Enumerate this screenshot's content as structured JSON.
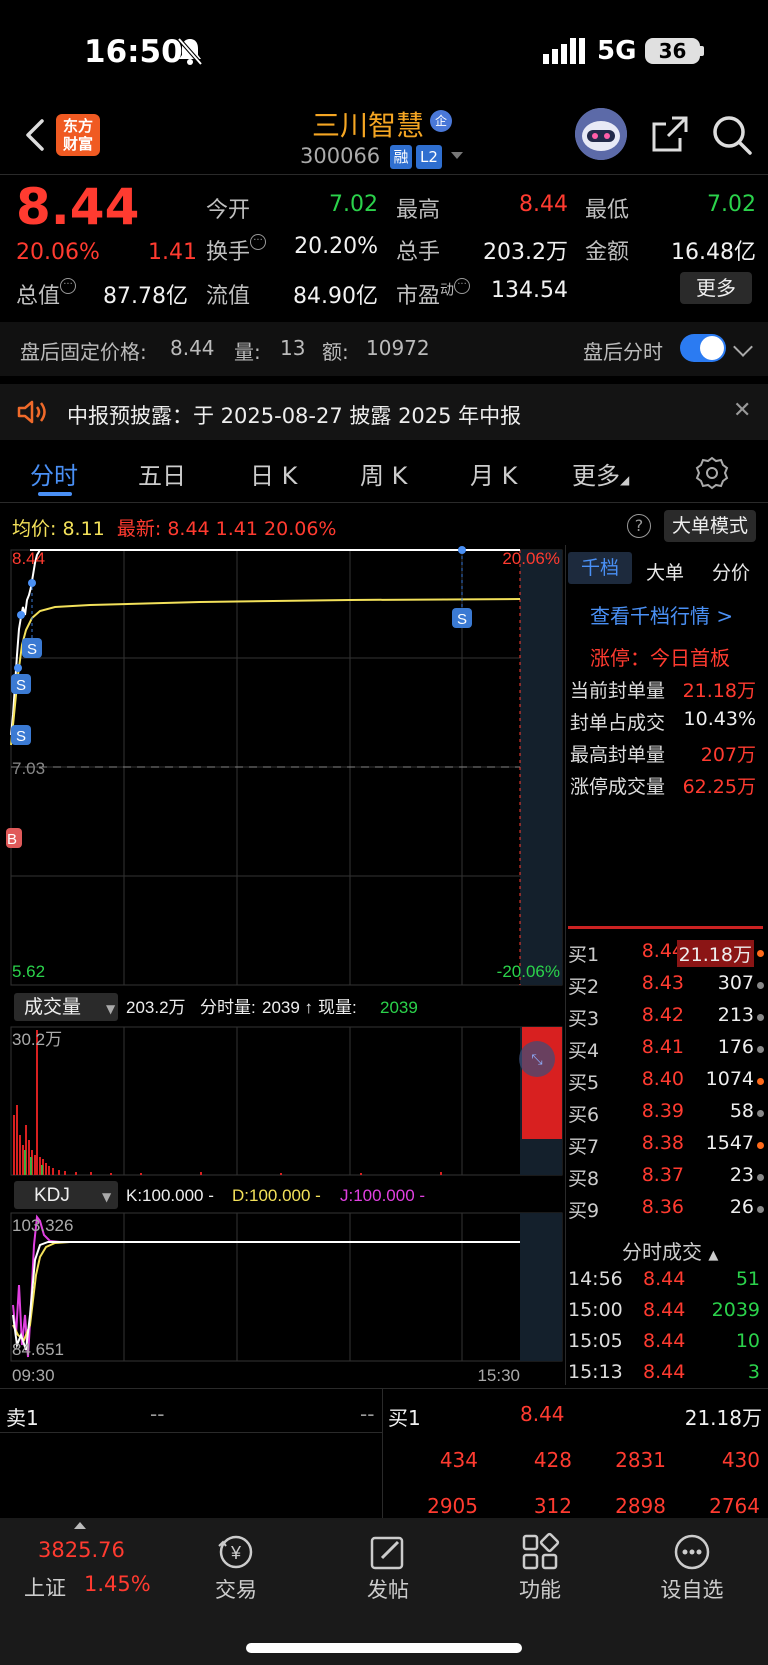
{
  "status_bar": {
    "time": "16:50",
    "network": "5G",
    "battery": "36"
  },
  "header": {
    "logo_line1": "东方",
    "logo_line2": "财富",
    "stock_name": "三川智慧",
    "name_badge": "企",
    "stock_code": "300066",
    "badge_margin": "融",
    "badge_level": "L2"
  },
  "quote": {
    "price": "8.44",
    "change_pct": "20.06%",
    "change_amt": "1.41",
    "fields": [
      {
        "label": "今开",
        "value": "7.02",
        "color": "green"
      },
      {
        "label": "最高",
        "value": "8.44",
        "color": "red"
      },
      {
        "label": "最低",
        "value": "7.02",
        "color": "green"
      },
      {
        "label": "换手",
        "value": "20.20%",
        "color": "white"
      },
      {
        "label": "总手",
        "value": "203.2万",
        "color": "white"
      },
      {
        "label": "金额",
        "value": "16.48亿",
        "color": "white"
      },
      {
        "label": "总值",
        "value": "87.78亿",
        "color": "white"
      },
      {
        "label": "流值",
        "value": "84.90亿",
        "color": "white"
      },
      {
        "label": "市盈",
        "label_sup": "动",
        "value": "134.54",
        "color": "white"
      }
    ],
    "more_button": "更多"
  },
  "after_hours": {
    "price_label": "盘后固定价格:",
    "price": "8.44",
    "volume_label": "量:",
    "volume": "13",
    "amount_label": "额:",
    "amount": "10972",
    "toggle_label": "盘后分时",
    "toggle_on": true
  },
  "notice": {
    "text": "中报预披露：于 2025-08-27 披露 2025 年中报"
  },
  "tabs": [
    "分时",
    "五日",
    "日 K",
    "周 K",
    "月 K",
    "更多"
  ],
  "price_bar": {
    "avg_label": "均价:",
    "avg_value": "8.11",
    "latest_label": "最新:",
    "latest_value": "8.44",
    "latest_change": "1.41",
    "latest_pct": "20.06%",
    "help": "?",
    "big_order_button": "大单模式"
  },
  "chart": {
    "price_high": "8.44",
    "price_mid": "7.03",
    "price_low": "5.62",
    "pct_high": "20.06%",
    "pct_low": "-20.06%",
    "volume_selector": "成交量",
    "volume_total": "203.2万",
    "volume_info_label": "分时量:",
    "volume_info_value": "2039 ↑",
    "volume_now_label": "现量:",
    "volume_now_value": "2039",
    "volume_max": "30.2万",
    "kdj_selector": "KDJ",
    "kdj_k": "K:100.000 -",
    "kdj_d": "D:100.000 -",
    "kdj_j": "J:100.000 -",
    "kdj_max": "103.326",
    "kdj_min": "84.651",
    "time_start": "09:30",
    "time_end": "15:30",
    "marker_s": "S",
    "marker_b": "B"
  },
  "right_panel": {
    "tabs": [
      "千档",
      "大单",
      "分价"
    ],
    "link": "查看千档行情 >",
    "limit_status": "涨停：今日首板",
    "stats": [
      {
        "label": "当前封单量",
        "value": "21.18万"
      },
      {
        "label": "封单占成交",
        "value": "10.43%"
      },
      {
        "label": "最高封单量",
        "value": "207万"
      },
      {
        "label": "涨停成交量",
        "value": "62.25万"
      }
    ],
    "bids": [
      {
        "label": "买1",
        "price": "8.44",
        "volume": "21.18万",
        "dot": "orange"
      },
      {
        "label": "买2",
        "price": "8.43",
        "volume": "307",
        "dot": "gray"
      },
      {
        "label": "买3",
        "price": "8.42",
        "volume": "213",
        "dot": "gray"
      },
      {
        "label": "买4",
        "price": "8.41",
        "volume": "176",
        "dot": "gray"
      },
      {
        "label": "买5",
        "price": "8.40",
        "volume": "1074",
        "dot": "orange"
      },
      {
        "label": "买6",
        "price": "8.39",
        "volume": "58",
        "dot": "gray"
      },
      {
        "label": "买7",
        "price": "8.38",
        "volume": "1547",
        "dot": "orange"
      },
      {
        "label": "买8",
        "price": "8.37",
        "volume": "23",
        "dot": "gray"
      },
      {
        "label": "买9",
        "price": "8.36",
        "volume": "26",
        "dot": "gray"
      }
    ],
    "trades_title": "分时成交",
    "trades": [
      {
        "time": "14:56",
        "price": "8.44",
        "volume": "51"
      },
      {
        "time": "15:00",
        "price": "8.44",
        "volume": "2039"
      },
      {
        "time": "15:05",
        "price": "8.44",
        "volume": "10"
      },
      {
        "time": "15:13",
        "price": "8.44",
        "volume": "3"
      }
    ]
  },
  "level1": {
    "sell_label": "卖1",
    "sell_price": "--",
    "sell_volume": "--",
    "buy_label": "买1",
    "buy_price": "8.44",
    "buy_volume": "21.18万",
    "queue_row1": [
      "434",
      "428",
      "2831",
      "430"
    ],
    "queue_row2": [
      "2905",
      "312",
      "2898",
      "2764"
    ]
  },
  "bottom_nav": {
    "index_value": "3825.76",
    "index_name": "上证",
    "index_pct": "1.45%",
    "items": [
      "交易",
      "发帖",
      "功能",
      "设自选"
    ]
  },
  "colors": {
    "up": "#ff3b30",
    "down": "#2bd24b",
    "accent": "#4a90f5",
    "avg_line": "#f3e15a",
    "brand": "#f05a22"
  }
}
